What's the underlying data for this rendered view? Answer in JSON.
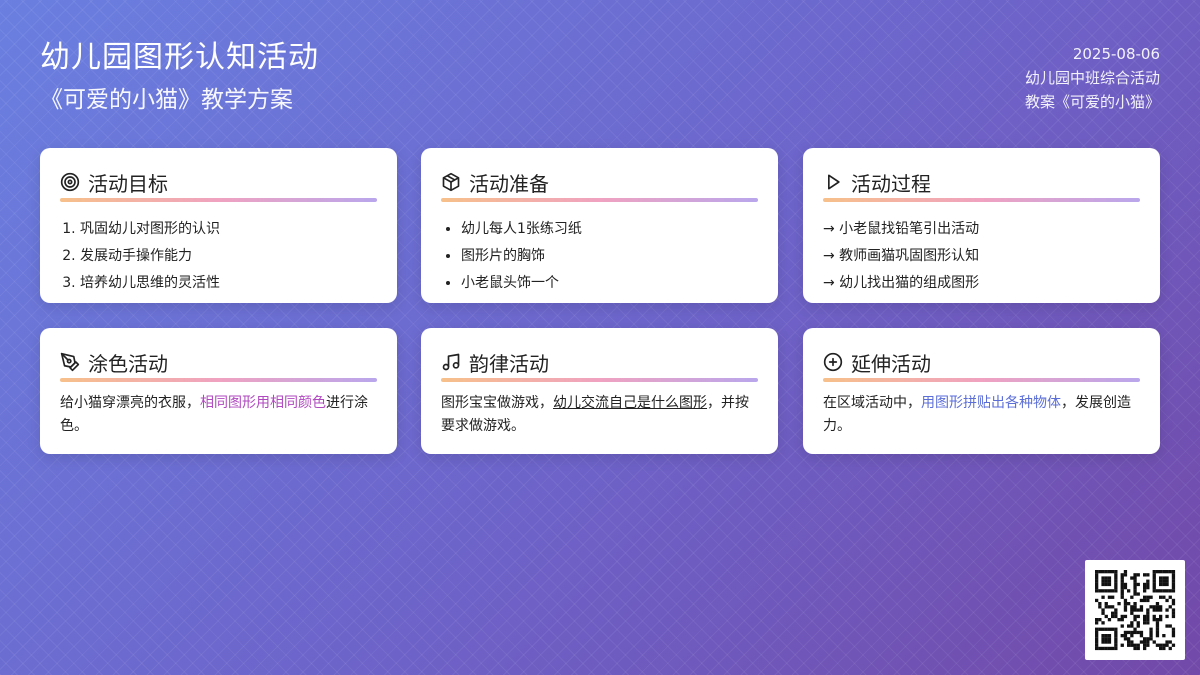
{
  "header": {
    "title": "幼儿园图形认知活动",
    "subtitle": "《可爱的小猫》教学方案"
  },
  "meta": {
    "date": "2025-08-06",
    "line1": "幼儿园中班综合活动",
    "line2": "教案《可爱的小猫》"
  },
  "cards": {
    "goals": {
      "title": "活动目标",
      "icon": "target-icon",
      "items": [
        "巩固幼儿对图形的认识",
        "发展动手操作能力",
        "培养幼儿思维的灵活性"
      ]
    },
    "prep": {
      "title": "活动准备",
      "icon": "box-icon",
      "items": [
        "幼儿每人1张练习纸",
        "图形片的胸饰",
        "小老鼠头饰一个"
      ]
    },
    "process": {
      "title": "活动过程",
      "icon": "play-icon",
      "items": [
        "→ 小老鼠找铅笔引出活动",
        "→ 教师画猫巩固图形认知",
        "→ 幼儿找出猫的组成图形"
      ]
    },
    "coloring": {
      "title": "涂色活动",
      "icon": "pen-tool-icon",
      "text_a": "给小猫穿漂亮的衣服，",
      "text_hl": "相同图形用相同颜色",
      "text_b": "进行涂色。"
    },
    "rhythm": {
      "title": "韵律活动",
      "icon": "music-icon",
      "text_a": "图形宝宝做游戏，",
      "text_hl": "幼儿交流自己是什么图形",
      "text_b": "，并按要求做游戏。"
    },
    "extension": {
      "title": "延伸活动",
      "icon": "plus-circle-icon",
      "text_a": "在区域活动中，",
      "text_hl": "用图形拼贴出各种物体",
      "text_b": "，发展创造力。"
    }
  },
  "colors": {
    "accent_pink": "#b049c0",
    "accent_blue": "#5b6ed8"
  }
}
